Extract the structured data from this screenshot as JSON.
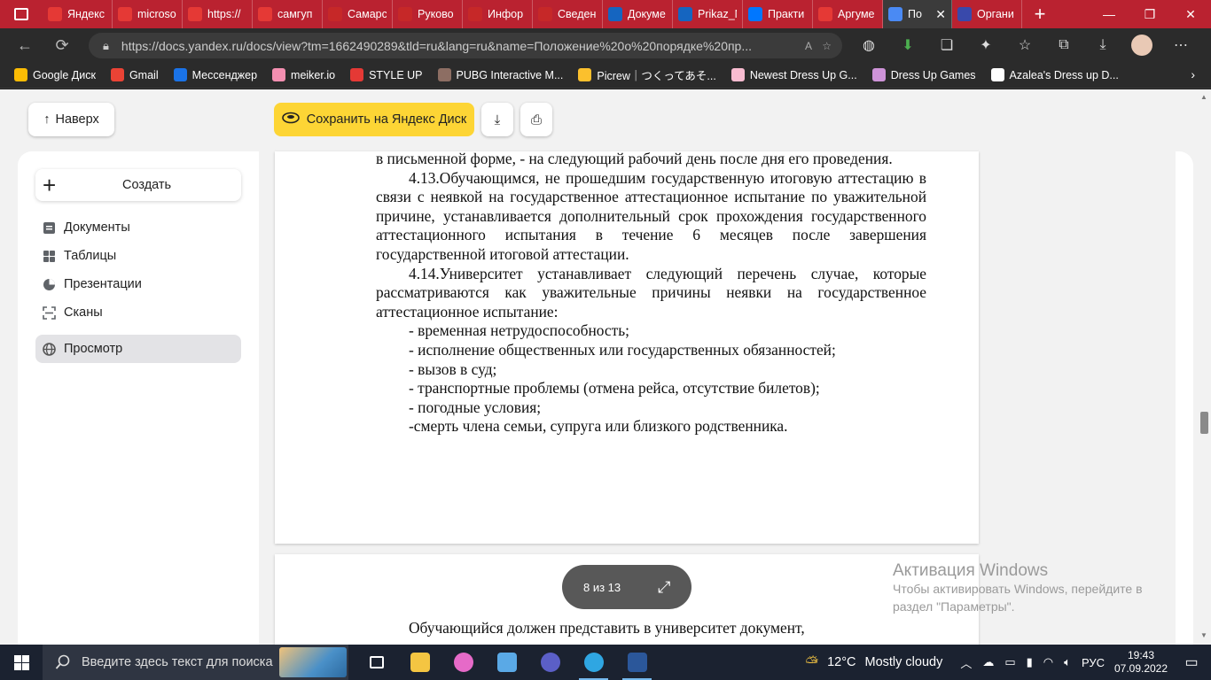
{
  "browser": {
    "tabs": [
      {
        "title": "Яндекс",
        "icon": "yandex-icon",
        "color": "#e53935"
      },
      {
        "title": "microso",
        "icon": "image-icon",
        "color": "#e53935"
      },
      {
        "title": "https://",
        "icon": "yandex-icon",
        "color": "#e53935"
      },
      {
        "title": "самгуп",
        "icon": "yandex-icon",
        "color": "#e53935"
      },
      {
        "title": "Самарс",
        "icon": "samgups-icon",
        "color": "#c62828"
      },
      {
        "title": "Руково",
        "icon": "samgups-icon",
        "color": "#c62828"
      },
      {
        "title": "Инфор",
        "icon": "samgups-icon",
        "color": "#c62828"
      },
      {
        "title": "Сведен",
        "icon": "samgups-icon",
        "color": "#c62828"
      },
      {
        "title": "Докуме",
        "icon": "samgups-icon",
        "color": "#1565c0"
      },
      {
        "title": "Prikaz_N",
        "icon": "samgups-icon",
        "color": "#1565c0"
      },
      {
        "title": "Практи",
        "icon": "vk-icon",
        "color": "#0077ff"
      },
      {
        "title": "Аргуме",
        "icon": "yandex-icon",
        "color": "#e53935"
      },
      {
        "title": "По",
        "icon": "yandex-docs-icon",
        "color": "#4a8af4",
        "active": true
      },
      {
        "title": "Органи",
        "icon": "b-icon",
        "color": "#3949ab"
      }
    ],
    "url": "https://docs.yandex.ru/docs/view?tm=1662490289&tld=ru&lang=ru&name=Положение%20о%20порядке%20пр...",
    "reader_label": "A",
    "bookmarks": [
      {
        "label": "Google Диск",
        "color": "#fbbc04"
      },
      {
        "label": "Gmail",
        "color": "#ea4335"
      },
      {
        "label": "Мессенджер",
        "color": "#1a73e8"
      },
      {
        "label": "meiker.io",
        "color": "#f48fb1"
      },
      {
        "label": "STYLE UP",
        "color": "#e53935"
      },
      {
        "label": "PUBG Interactive M...",
        "color": "#8d6e63"
      },
      {
        "label": "Picrew｜つくってあそ...",
        "color": "#fbc02d"
      },
      {
        "label": "Newest Dress Up G...",
        "color": "#f8bbd0"
      },
      {
        "label": "Dress Up Games",
        "color": "#ce93d8"
      },
      {
        "label": "Azalea's Dress up D...",
        "color": "#ffffff"
      }
    ]
  },
  "toolbar": {
    "up_label": "Наверх",
    "save_label": "Сохранить на Яндекс Диск"
  },
  "sidebar": {
    "create_label": "Создать",
    "items": [
      {
        "label": "Документы",
        "icon": "document-icon"
      },
      {
        "label": "Таблицы",
        "icon": "table-icon"
      },
      {
        "label": "Презентации",
        "icon": "presentation-icon"
      },
      {
        "label": "Сканы",
        "icon": "scan-icon"
      }
    ],
    "selected": {
      "label": "Просмотр",
      "icon": "globe-icon"
    }
  },
  "document": {
    "lines": [
      {
        "type": "cont",
        "text": "в письменной форме, - на следующий рабочий день после дня его проведения."
      },
      {
        "type": "para",
        "text": "4.13.Обучающимся, не прошедшим государственную итоговую аттестацию в связи с неявкой на государственное аттестационное испытание по уважительной причине, устанавливается дополнительный срок прохождения государственного аттестационного испытания в течение 6 месяцев после завершения государственной итоговой аттестации."
      },
      {
        "type": "para",
        "text": "4.14.Университет устанавливает следующий перечень случае, которые рассматриваются как уважительные причины неявки на государственное аттестационное испытание:"
      },
      {
        "type": "item",
        "text": "- временная нетрудоспособность;"
      },
      {
        "type": "item",
        "text": "- исполнение общественных или государственных обязанностей;"
      },
      {
        "type": "item",
        "text": "- вызов в суд;"
      },
      {
        "type": "item",
        "text": "- транспортные проблемы (отмена рейса, отсутствие билетов);"
      },
      {
        "type": "item",
        "text": "- погодные условия;"
      },
      {
        "type": "item",
        "text": "-смерть члена семьи, супруга или близкого родственника."
      }
    ],
    "next_page_text": "Обучающийся должен представить в университет документ,"
  },
  "pager": {
    "text": "8 из 13"
  },
  "watermark": {
    "title": "Активация Windows",
    "line1": "Чтобы активировать Windows, перейдите в",
    "line2": "раздел \"Параметры\"."
  },
  "taskbar": {
    "search_placeholder": "Введите здесь текст для поиска",
    "apps": [
      {
        "icon": "task-view-icon",
        "color": "#ffffff"
      },
      {
        "icon": "file-explorer-icon",
        "color": "#f4c542"
      },
      {
        "icon": "paint3d-icon",
        "color": "#e66ac8"
      },
      {
        "icon": "photos-icon",
        "color": "#5aa9e6"
      },
      {
        "icon": "teams-icon",
        "color": "#5b5fc7"
      },
      {
        "icon": "edge-icon",
        "color": "#2fa6e2",
        "active": true
      },
      {
        "icon": "word-icon",
        "color": "#2b579a",
        "active": true
      }
    ],
    "weather_temp": "12°C",
    "weather_desc": "Mostly cloudy",
    "language": "РУС",
    "time": "19:43",
    "date": "07.09.2022"
  }
}
